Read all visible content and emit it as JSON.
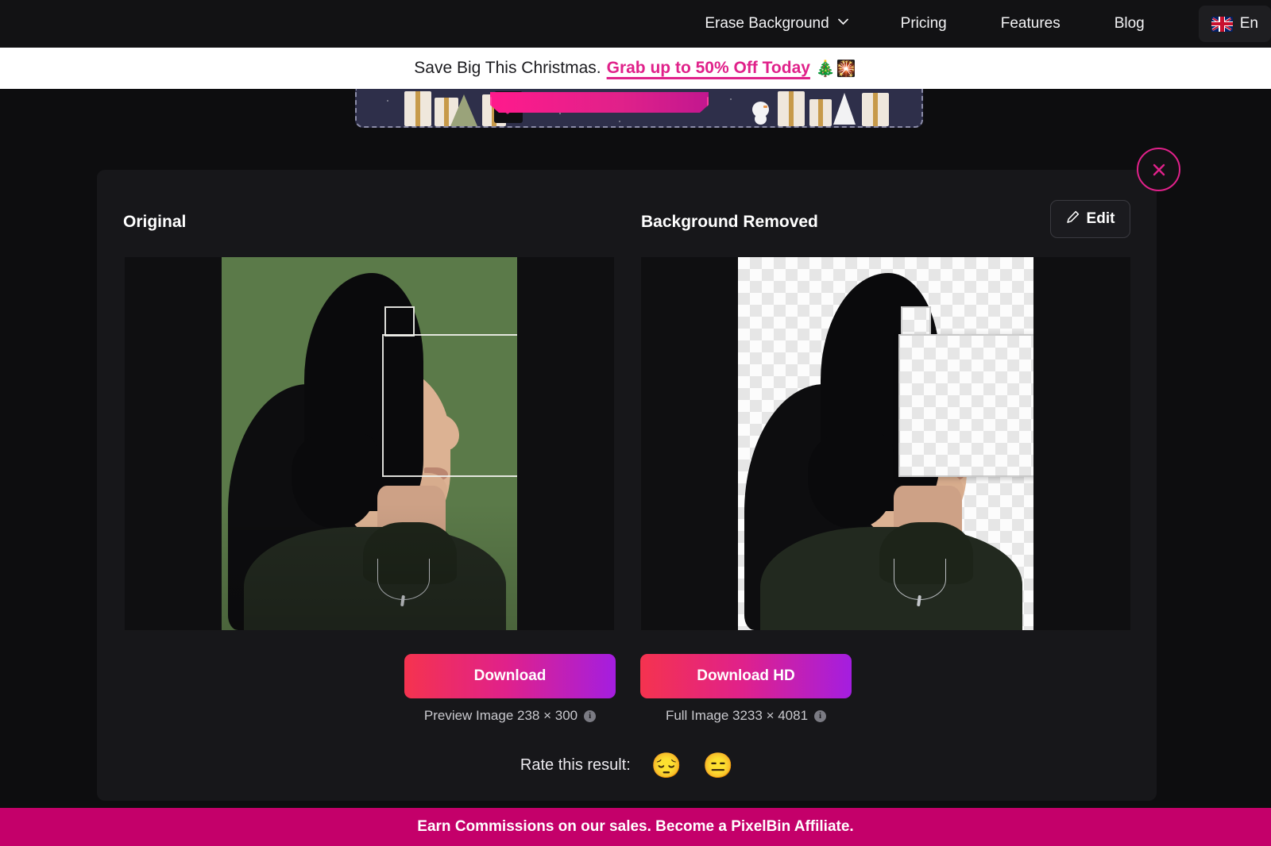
{
  "nav": {
    "items": [
      {
        "label": "Erase Background",
        "icon": "chevron-down-icon",
        "has_chevron": true
      },
      {
        "label": "Pricing",
        "has_chevron": false
      },
      {
        "label": "Features",
        "has_chevron": false
      },
      {
        "label": "Blog",
        "has_chevron": false
      }
    ],
    "language": {
      "label": "En",
      "icon": "uk-flag-icon"
    }
  },
  "promo": {
    "text": "Save Big This Christmas.",
    "link_text": "Grab up to 50% Off Today",
    "emoji": "🎄🎇",
    "link_color": "#e0218a"
  },
  "xmas_card": {
    "alt": "christmas-promo-banner",
    "background": "#2e2f4a"
  },
  "card": {
    "close_icon": "close-icon",
    "left": {
      "label": "Original"
    },
    "right": {
      "label": "Background Removed"
    },
    "edit_button": {
      "label": "Edit",
      "icon": "pencil-icon"
    },
    "selection": {
      "small_box": "selection-box-small",
      "large_box": "selection-box-large"
    }
  },
  "downloads": [
    {
      "button_label": "Download",
      "caption": "Preview Image 238 × 300",
      "info_icon": "info-icon"
    },
    {
      "button_label": "Download HD",
      "caption": "Full Image 3233 × 4081",
      "info_icon": "info-icon"
    }
  ],
  "rate": {
    "label": "Rate this result:",
    "options": [
      {
        "emoji": "😔",
        "name": "rate-sad"
      },
      {
        "emoji": "😑",
        "name": "rate-neutral"
      }
    ]
  },
  "affiliate": {
    "text": "Earn Commissions on our sales. Become a PixelBin Affiliate.",
    "background": "#c4006a"
  },
  "colors": {
    "accent_pink": "#e0218a",
    "gradient_start": "#f5334f",
    "gradient_end": "#a41ee0",
    "page_bg": "#0d0d0f",
    "card_bg": "#17171a"
  }
}
